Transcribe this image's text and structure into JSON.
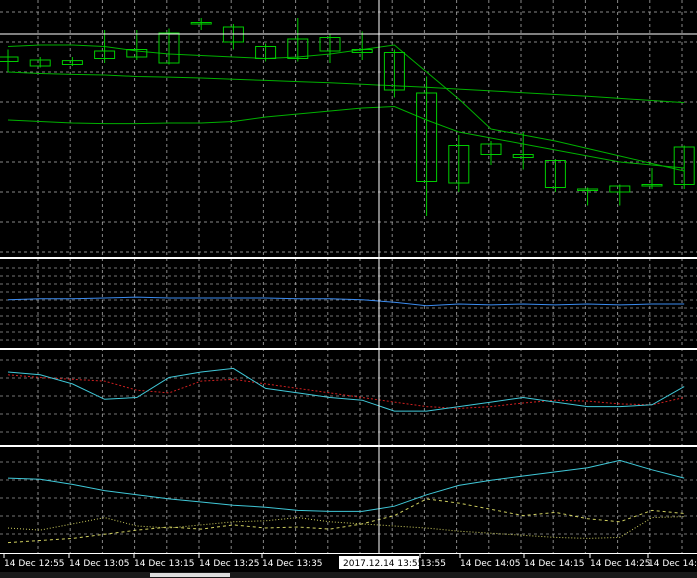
{
  "theme": {
    "background": "#000000",
    "grid": "#c0c0c0",
    "separator": "#ffffff",
    "crosshair": "#ffffff",
    "bull_body": "#ffffff",
    "wick": "#00cc00",
    "ma_line": "#00b000",
    "indicator_cyan": "#40c8d8",
    "indicator_blue": "#3c8cf0",
    "indicator_red": "#d02020",
    "indicator_yellow": "#d0d060"
  },
  "time_axis": {
    "labels": [
      "14 Dec 12:55",
      "14 Dec 13:05",
      "14 Dec 13:15",
      "14 Dec 13:25",
      "14 Dec 13:35",
      "13:55",
      "14 Dec 14:05",
      "14 Dec 14:15",
      "14 Dec 14:25",
      "14 Dec 14:35"
    ],
    "crosshair_label": "2017.12.14 13:55"
  },
  "chart_data": {
    "type": "candlestick",
    "panes": 4,
    "candles": [
      {
        "o": 59.5,
        "c": 61.0,
        "h": 63.5,
        "l": 56.0
      },
      {
        "o": 58.0,
        "c": 60.0,
        "h": 61.0,
        "l": 57.5
      },
      {
        "o": 58.5,
        "c": 59.8,
        "h": 61.0,
        "l": 58.0
      },
      {
        "o": 60.5,
        "c": 63.0,
        "h": 70.0,
        "l": 59.0
      },
      {
        "o": 61.0,
        "c": 63.5,
        "h": 70.0,
        "l": 60.0
      },
      {
        "o": 59.0,
        "c": 69.0,
        "h": 70.5,
        "l": 58.5
      },
      {
        "o": 72.0,
        "c": 72.5,
        "h": 74.0,
        "l": 70.0
      },
      {
        "o": 66.0,
        "c": 71.0,
        "h": 72.0,
        "l": 63.5
      },
      {
        "o": 60.5,
        "c": 64.5,
        "h": 65.5,
        "l": 59.5
      },
      {
        "o": 60.5,
        "c": 67.0,
        "h": 74.0,
        "l": 59.5
      },
      {
        "o": 63.0,
        "c": 67.5,
        "h": 68.5,
        "l": 59.0
      },
      {
        "o": 62.5,
        "c": 63.5,
        "h": 69.5,
        "l": 60.0
      },
      {
        "o": 50.0,
        "c": 62.5,
        "h": 63.5,
        "l": 47.5
      },
      {
        "o": 19.5,
        "c": 49.0,
        "h": 54.5,
        "l": 8.0
      },
      {
        "o": 19.0,
        "c": 31.5,
        "h": 35.0,
        "l": 16.0
      },
      {
        "o": 28.5,
        "c": 32.0,
        "h": 33.0,
        "l": 25.0
      },
      {
        "o": 27.5,
        "c": 28.5,
        "h": 36.0,
        "l": 23.5
      },
      {
        "o": 17.5,
        "c": 26.5,
        "h": 27.0,
        "l": 16.0
      },
      {
        "o": 16.5,
        "c": 17.0,
        "h": 17.5,
        "l": 11.5
      },
      {
        "o": 16.0,
        "c": 18.0,
        "h": 18.5,
        "l": 11.5
      },
      {
        "o": 18.0,
        "c": 18.5,
        "h": 24.0,
        "l": 17.0
      },
      {
        "o": 18.5,
        "c": 31.0,
        "h": 31.5,
        "l": 17.0
      }
    ],
    "ma_fast": [
      64.5,
      65.0,
      65.0,
      64.5,
      63.0,
      62.0,
      61.5,
      61.0,
      60.5,
      61.0,
      62.0,
      63.5,
      65.0,
      56.0,
      47.0,
      37.0,
      35.0,
      33.0,
      30.5,
      28.0,
      25.5,
      23.0
    ],
    "ma_slow": [
      56.0,
      55.5,
      55.2,
      55.0,
      54.5,
      54.3,
      54.0,
      53.6,
      53.2,
      52.8,
      52.4,
      51.9,
      51.4,
      50.9,
      50.3,
      49.7,
      49.1,
      48.5,
      47.9,
      47.2,
      46.5,
      45.8
    ],
    "ma_lower": [
      40.0,
      39.5,
      39.0,
      38.8,
      38.8,
      39.0,
      39.0,
      39.5,
      41.0,
      42.0,
      43.0,
      44.0,
      44.5,
      40.0,
      36.0,
      34.0,
      32.0,
      30.0,
      28.0,
      26.0,
      25.0,
      24.0
    ],
    "rsi_blue": [
      55,
      56,
      56,
      57,
      58,
      57,
      57,
      57,
      57,
      56,
      56,
      55,
      52,
      48,
      50,
      49,
      50,
      49,
      50,
      49,
      50,
      50
    ],
    "stoch_main": [
      78,
      75,
      65,
      48,
      50,
      72,
      78,
      82,
      60,
      55,
      50,
      47,
      35,
      35,
      40,
      45,
      50,
      45,
      40,
      40,
      42,
      62
    ],
    "stoch_signal": [
      75,
      72,
      70,
      68,
      58,
      55,
      68,
      70,
      65,
      60,
      55,
      50,
      45,
      40,
      38,
      40,
      44,
      47,
      46,
      43,
      42,
      50
    ],
    "osc_cyan": [
      72,
      71,
      66,
      60,
      56,
      52,
      49,
      46,
      44,
      41,
      40,
      40,
      45,
      56,
      65,
      70,
      74,
      78,
      82,
      89,
      80,
      72
    ],
    "osc_yellow_dash": [
      10,
      12,
      14,
      18,
      22,
      25,
      23,
      27,
      24,
      25,
      23,
      28,
      36,
      52,
      48,
      42,
      36,
      39,
      33,
      30,
      41,
      38
    ],
    "osc_yellow_dot": [
      24,
      22,
      28,
      34,
      26,
      24,
      27,
      30,
      31,
      34,
      30,
      28,
      26,
      24,
      21,
      19,
      17,
      15,
      14,
      15,
      34,
      35
    ]
  }
}
